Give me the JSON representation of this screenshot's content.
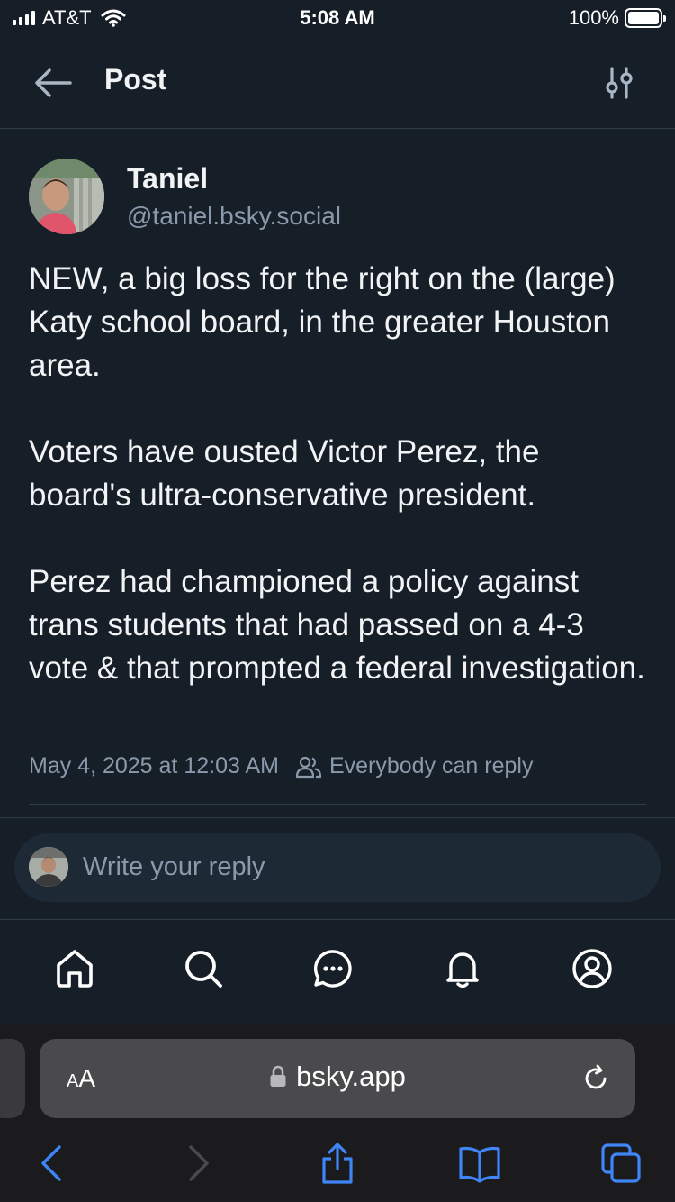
{
  "status_bar": {
    "carrier": "AT&T",
    "time": "5:08 AM",
    "battery": "100%"
  },
  "header": {
    "title": "Post",
    "back_icon": "arrow-left-icon",
    "settings_icon": "sliders-icon"
  },
  "post": {
    "author_name": "Taniel",
    "author_handle": "@taniel.bsky.social",
    "paragraphs": [
      "NEW, a big loss for the right on the (large) Katy school board, in the greater Houston area.",
      "Voters have ousted Victor Perez, the board's ultra-conservative president.",
      "Perez had championed a policy against trans students that had passed on a 4-3 vote & that prompted a federal investigation."
    ],
    "timestamp": "May 4, 2025 at 12:03 AM",
    "reply_setting": "Everybody can reply"
  },
  "reply": {
    "placeholder": "Write your reply"
  },
  "bottom_nav": {
    "items": [
      {
        "icon": "home-icon"
      },
      {
        "icon": "search-icon"
      },
      {
        "icon": "chat-icon"
      },
      {
        "icon": "bell-icon"
      },
      {
        "icon": "profile-icon"
      }
    ]
  },
  "browser": {
    "text_size_small": "A",
    "text_size_big": "A",
    "url": "bsky.app"
  },
  "colors": {
    "background": "#161e27",
    "divider": "#2c3a4a",
    "muted_text": "#8b9aab",
    "link_blue": "#3f85f7"
  }
}
